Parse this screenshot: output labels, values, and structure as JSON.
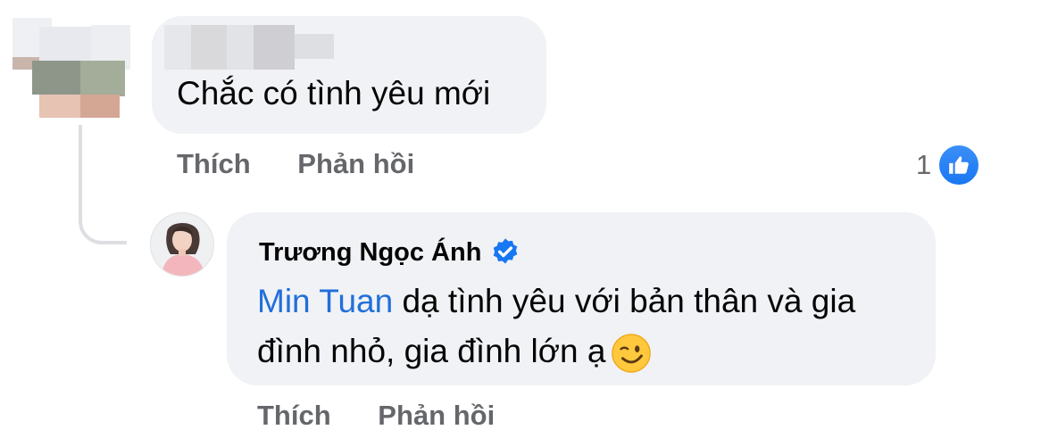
{
  "comment1": {
    "text": "Chắc có tình yêu mới",
    "actions": {
      "like": "Thích",
      "reply": "Phản hồi"
    },
    "reaction_count": "1",
    "reaction_icon": "like-thumb-icon"
  },
  "reply": {
    "author": "Trương Ngọc Ánh",
    "verified_icon": "verified-badge-icon",
    "mention": "Min Tuan",
    "text": " dạ tình yêu với bản thân và gia đình nhỏ, gia đình lớn ạ",
    "emoji": "winking-face-emoji",
    "actions": {
      "like": "Thích",
      "reply": "Phản hồi"
    }
  },
  "colors": {
    "bubble": "#f0f2f5",
    "mention": "#216fdb",
    "action_text": "#65676b",
    "like_blue": "#1877f2"
  }
}
